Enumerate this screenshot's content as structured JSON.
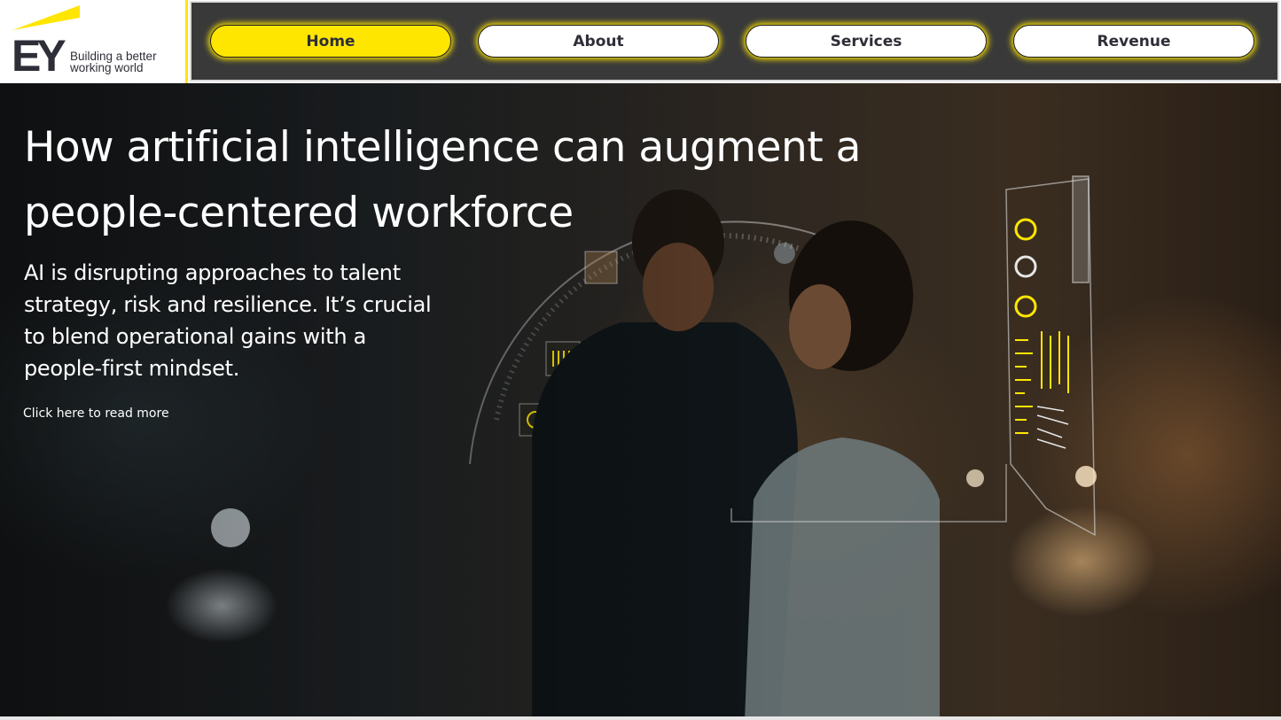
{
  "brand": {
    "logo_text": "EY",
    "tagline_line1": "Building a better",
    "tagline_line2": "working world",
    "accent": "#FFE600",
    "dark": "#2E2E38"
  },
  "nav": {
    "items": [
      {
        "label": "Home",
        "active": true
      },
      {
        "label": "About",
        "active": false
      },
      {
        "label": "Services",
        "active": false
      },
      {
        "label": "Revenue",
        "active": false
      }
    ]
  },
  "hero": {
    "title": "How artificial intelligence can augment a people-centered workforce",
    "subtitle": "AI is disrupting approaches to talent strategy, risk and resilience. It’s crucial to blend operational gains with a people-first mindset.",
    "link": "Click here to read more"
  },
  "icons": [
    "ey-logo-icon",
    "hologram-ring-icon",
    "hologram-panel-icon"
  ]
}
